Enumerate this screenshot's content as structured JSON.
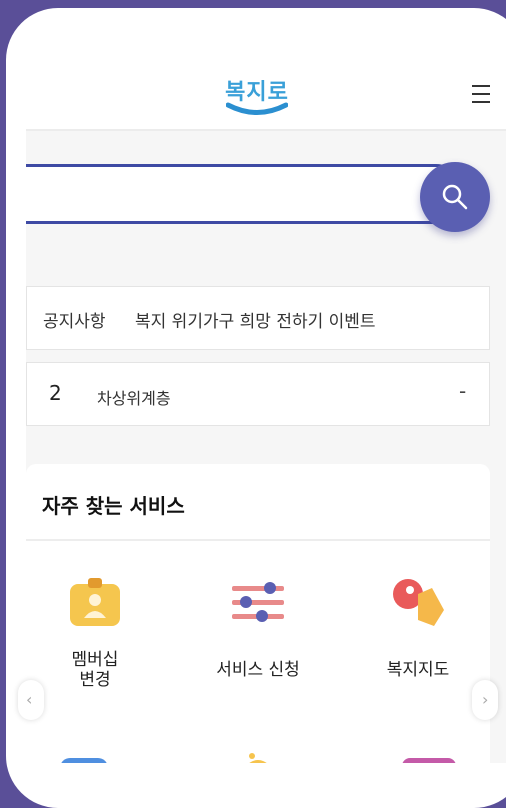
{
  "header": {
    "logo_text": "복지로",
    "menu_icon": "hamburger-menu-icon"
  },
  "search": {
    "placeholder": "",
    "value": "",
    "button_icon": "search-icon"
  },
  "notice": {
    "label": "공지사항",
    "text": "복지 위기가구 희망 전하기 이벤트"
  },
  "ranking": {
    "number": "2",
    "text": "차상위계층",
    "change": "-"
  },
  "services": {
    "title": "자주 찾는 서비스",
    "items": [
      {
        "label": "멤버십\n변경",
        "icon": "id-badge-icon"
      },
      {
        "label": "서비스 신청",
        "icon": "sliders-icon"
      },
      {
        "label": "복지지도",
        "icon": "map-pointer-icon"
      }
    ],
    "row2_icons": [
      "chat-bubble-icon",
      "bulb-icon",
      "wallet-icon"
    ]
  },
  "colors": {
    "background": "#5a4f98",
    "accent": "#3e4aa4",
    "logo": "#3aa0d8",
    "search_button": "#5a5fb2"
  }
}
